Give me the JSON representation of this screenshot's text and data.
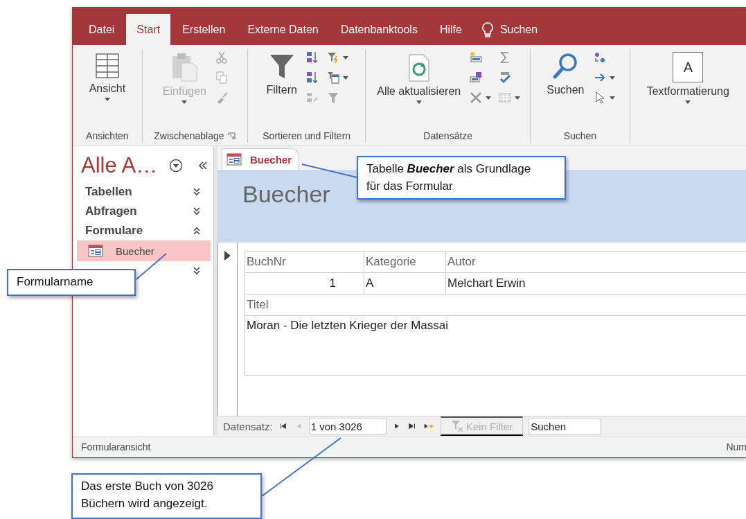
{
  "ribbon_tabs": [
    {
      "label": "Datei",
      "selected": false
    },
    {
      "label": "Start",
      "selected": true
    },
    {
      "label": "Erstellen",
      "selected": false
    },
    {
      "label": "Externe Daten",
      "selected": false
    },
    {
      "label": "Datenbanktools",
      "selected": false
    },
    {
      "label": "Hilfe",
      "selected": false
    }
  ],
  "tell_me": {
    "label": "Suchen"
  },
  "ribbon_groups": [
    {
      "label": "Ansichten",
      "buttons": [
        {
          "label": "Ansicht",
          "disabled": false,
          "dropdown": true
        }
      ]
    },
    {
      "label": "Zwischenablage",
      "buttons": [
        {
          "label": "Einfügen",
          "disabled": true,
          "dropdown": true
        }
      ]
    },
    {
      "label": "Sortieren und Filtern",
      "buttons": [
        {
          "label": "Filtern",
          "disabled": false,
          "dropdown": false
        }
      ]
    },
    {
      "label": "Datensätze",
      "buttons": [
        {
          "label": "Alle aktualisieren",
          "disabled": false,
          "dropdown": true
        }
      ]
    },
    {
      "label": "Suchen",
      "buttons": [
        {
          "label": "Suchen",
          "disabled": false,
          "dropdown": false
        }
      ]
    },
    {
      "buttons": [
        {
          "label": "Textformatierung",
          "disabled": false,
          "dropdown": true,
          "icon_text": "A"
        }
      ]
    }
  ],
  "nav_pane": {
    "title": "Alle A…",
    "groups": [
      {
        "label": "Tabellen",
        "expanded": false
      },
      {
        "label": "Abfragen",
        "expanded": false
      },
      {
        "label": "Formulare",
        "expanded": true,
        "children": [
          {
            "label": "Buecher",
            "selected": true
          }
        ]
      },
      {
        "expanded": false
      }
    ]
  },
  "document_tab": {
    "label": "Buecher"
  },
  "form": {
    "header": "Buecher",
    "fields": [
      {
        "label": "BuchNr",
        "value": "1",
        "kind": "number"
      },
      {
        "label": "Kategorie",
        "value": "A",
        "kind": "text"
      },
      {
        "label": "Autor",
        "value": "Melchart Erwin",
        "kind": "text"
      },
      {
        "label": "Titel",
        "value": "Moran - Die letzten Krieger der Massai",
        "kind": "memo"
      }
    ]
  },
  "record_nav": {
    "label": "Datensatz:",
    "position": "1 von 3026",
    "filter": {
      "label": "Kein Filter",
      "disabled": true
    },
    "search": {
      "placeholder": "Suchen"
    }
  },
  "status_bar": {
    "left": "Formularansicht",
    "right": "Num"
  },
  "callouts": [
    {
      "text": "Tabelle **Buecher** als Grundlage für das Formular"
    },
    {
      "text": "Formularname"
    },
    {
      "text": "Das erste Buch von 3026 Büchern wird angezeigt."
    }
  ]
}
